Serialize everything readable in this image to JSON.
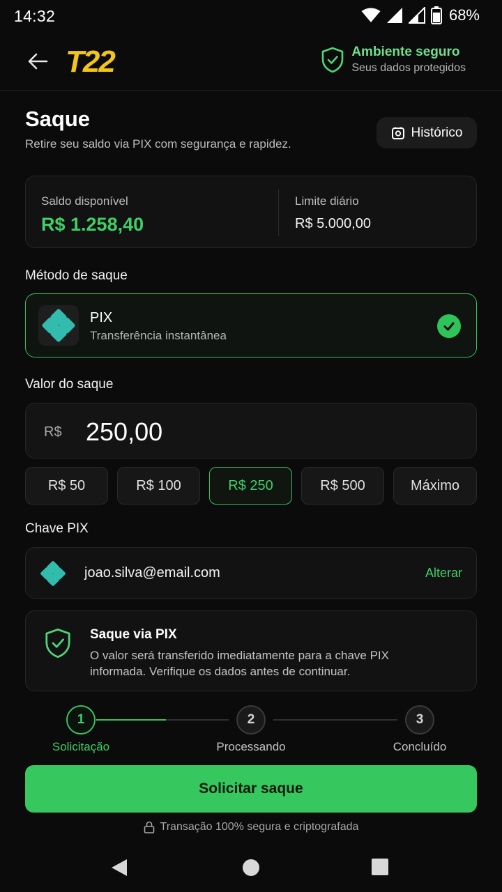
{
  "status_bar": {
    "time": "14:32",
    "battery": "68%"
  },
  "header": {
    "logo_text": "T22",
    "secure_title": "Ambiente seguro",
    "secure_subtitle": "Seus dados protegidos"
  },
  "page": {
    "title": "Saque",
    "subtitle": "Retire seu saldo via PIX com segurança e rapidez.",
    "history_label": "Histórico"
  },
  "balance": {
    "available_label": "Saldo disponível",
    "available_value": "R$ 1.258,40",
    "limit_label": "Limite diário",
    "limit_value": "R$ 5.000,00"
  },
  "method": {
    "section_label": "Método de saque",
    "name": "PIX",
    "description": "Transferência instantânea",
    "selected": true
  },
  "amount": {
    "section_label": "Valor do saque",
    "currency": "R$",
    "value": "250,00",
    "chips": [
      {
        "label": "R$ 50",
        "active": false
      },
      {
        "label": "R$ 100",
        "active": false
      },
      {
        "label": "R$ 250",
        "active": true
      },
      {
        "label": "R$ 500",
        "active": false
      },
      {
        "label": "Máximo",
        "active": false
      }
    ]
  },
  "pix_key": {
    "section_label": "Chave PIX",
    "value": "joao.silva@email.com",
    "change_label": "Alterar"
  },
  "info": {
    "title": "Saque via PIX",
    "text": "O valor será transferido imediatamente para a chave PIX informada. Verifique os dados antes de continuar."
  },
  "steps": [
    {
      "number": "1",
      "label": "Solicitação",
      "active": true
    },
    {
      "number": "2",
      "label": "Processando",
      "active": false
    },
    {
      "number": "3",
      "label": "Concluído",
      "active": false
    }
  ],
  "cta": {
    "label": "Solicitar saque",
    "note": "Transação 100% segura e criptografada"
  },
  "colors": {
    "accent": "#36c75f",
    "background": "#0b0b0b",
    "card": "#121212"
  }
}
